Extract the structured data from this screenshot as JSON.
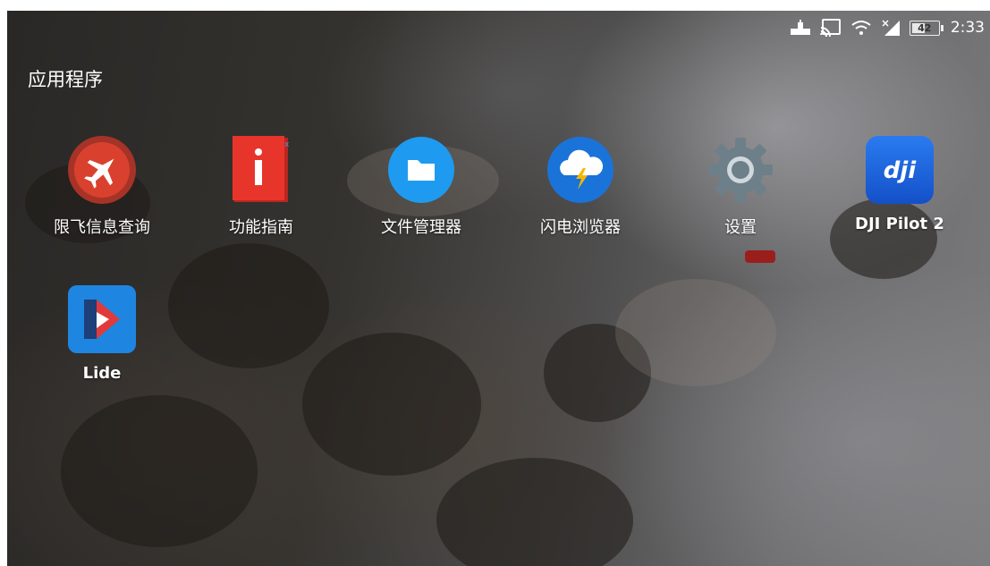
{
  "status_bar": {
    "icons": [
      "usb-debug-icon",
      "cast-icon",
      "wifi-icon",
      "mobile-signal-icon"
    ],
    "battery_level": "42",
    "time": "2:33"
  },
  "section_title": "应用程序",
  "apps": [
    {
      "label": "限飞信息查询",
      "icon": "no-fly-zone-icon",
      "color": "#d9412e"
    },
    {
      "label": "功能指南",
      "icon": "guide-book-icon",
      "color": "#e8352c"
    },
    {
      "label": "文件管理器",
      "icon": "folder-icon",
      "color": "#1e9bf0"
    },
    {
      "label": "闪电浏览器",
      "icon": "lightning-browser-icon",
      "color": "#1a73d9"
    },
    {
      "label": "设置",
      "icon": "gear-icon",
      "color": "#6d7f88"
    },
    {
      "label": "DJI Pilot 2",
      "icon": "dji-logo-icon",
      "color": "#1565e0"
    },
    {
      "label": "Lide",
      "icon": "lide-logo-icon",
      "color": "#1e86e0"
    }
  ]
}
